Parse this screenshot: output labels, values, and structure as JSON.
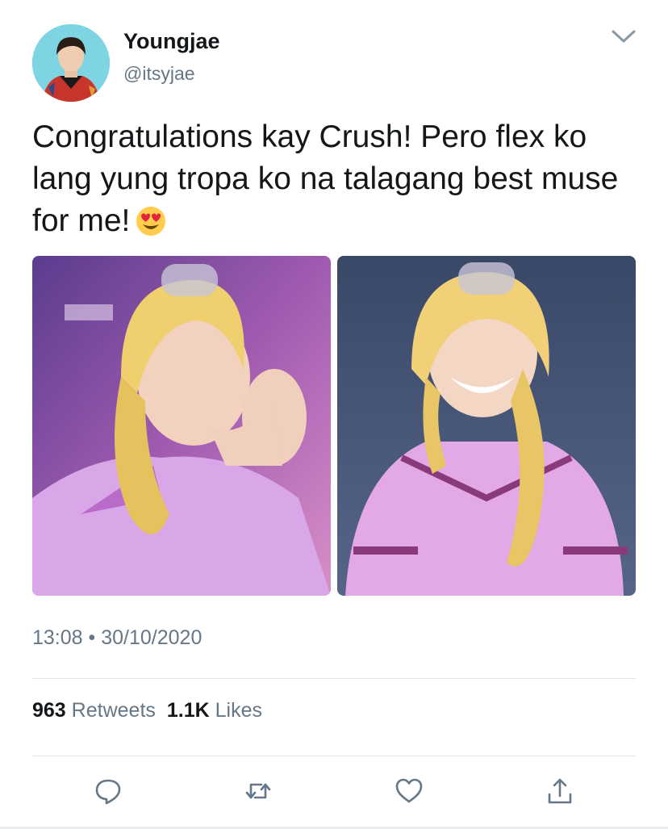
{
  "author": {
    "name": "Youngjae",
    "handle": "@itsyjae"
  },
  "tweet": {
    "text": "Congratulations kay Crush! Pero flex ko lang yung tropa ko na talagang best muse for me!",
    "emoji": "heart-eyes-face",
    "time": "13:08",
    "separator": "•",
    "date": "30/10/2020"
  },
  "stats": {
    "retweets_count": "963",
    "retweets_label": "Retweets",
    "likes_count": "1.1K",
    "likes_label": "Likes"
  },
  "media": {
    "count": 2
  },
  "actions": [
    "reply-icon",
    "retweet-icon",
    "like-icon",
    "share-icon"
  ],
  "colors": {
    "text": "#14171a",
    "secondary": "#657786",
    "divider": "#dfe3e6",
    "avatar_bg": "#7fd4e3"
  }
}
